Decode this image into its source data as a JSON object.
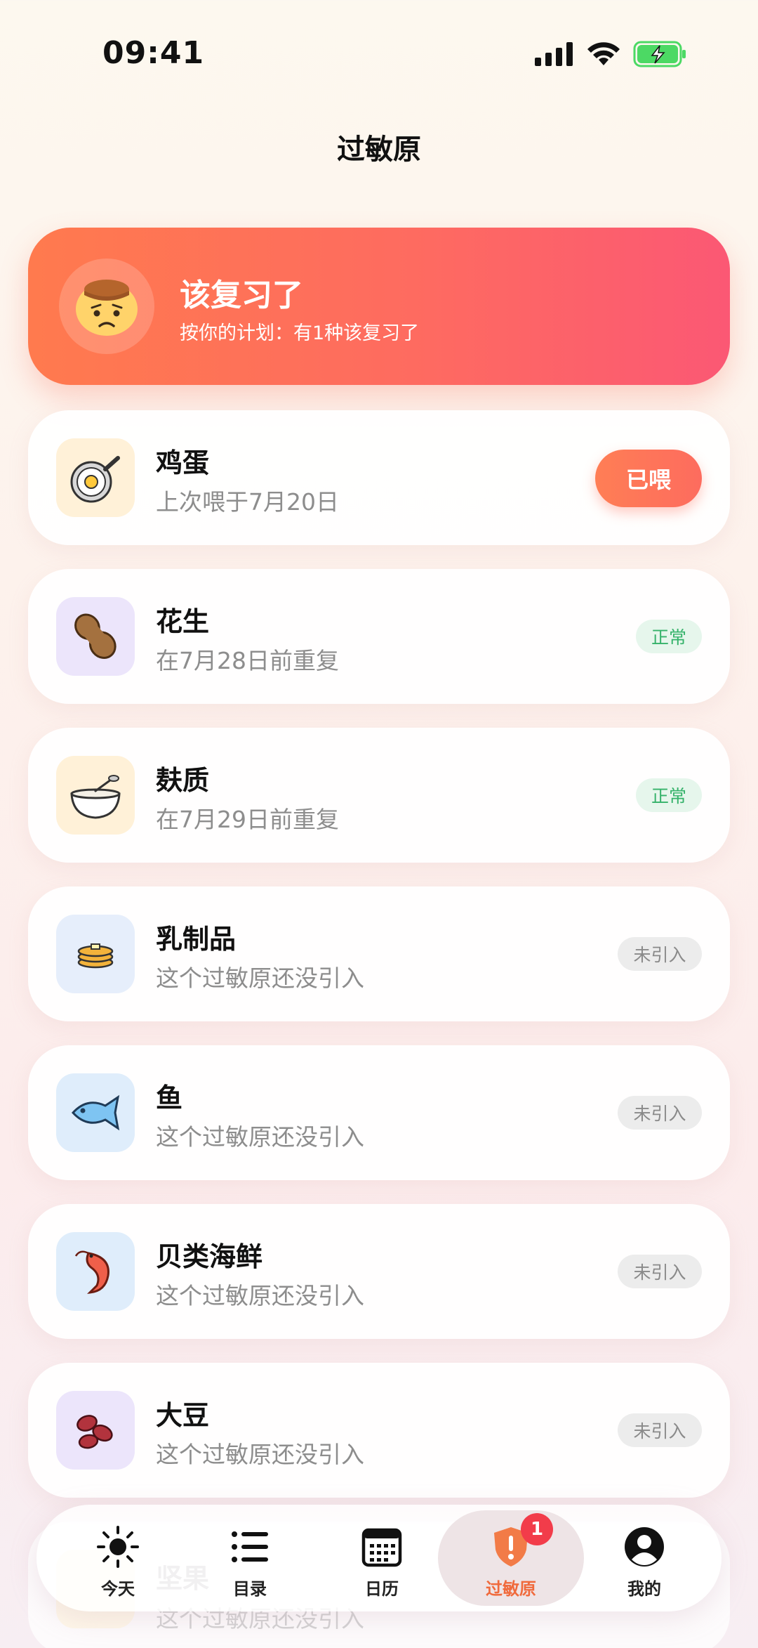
{
  "status_bar": {
    "time": "09:41"
  },
  "header": {
    "title": "过敏原"
  },
  "review_banner": {
    "title": "该复习了",
    "subtitle": "按你的计划：有1种该复习了"
  },
  "allergens": [
    {
      "name": "鸡蛋",
      "subtitle": "上次喂于7月20日",
      "action": "已喂",
      "icon": "egg-pan-icon"
    },
    {
      "name": "花生",
      "subtitle": "在7月28日前重复",
      "status": "正常",
      "icon": "peanut-icon"
    },
    {
      "name": "麸质",
      "subtitle": "在7月29日前重复",
      "status": "正常",
      "icon": "bowl-icon"
    },
    {
      "name": "乳制品",
      "subtitle": "这个过敏原还没引入",
      "status": "未引入",
      "icon": "pancake-icon"
    },
    {
      "name": "鱼",
      "subtitle": "这个过敏原还没引入",
      "status": "未引入",
      "icon": "fish-icon"
    },
    {
      "name": "贝类海鲜",
      "subtitle": "这个过敏原还没引入",
      "status": "未引入",
      "icon": "shrimp-icon"
    },
    {
      "name": "大豆",
      "subtitle": "这个过敏原还没引入",
      "status": "未引入",
      "icon": "beans-icon"
    },
    {
      "name": "坚果",
      "subtitle": "这个过敏原还没引入",
      "icon": "nut-icon"
    }
  ],
  "tab_bar": {
    "tabs": [
      {
        "label": "今天",
        "icon": "sun-icon"
      },
      {
        "label": "目录",
        "icon": "list-icon"
      },
      {
        "label": "日历",
        "icon": "calendar-icon"
      },
      {
        "label": "过敏原",
        "icon": "shield-alert-icon",
        "badge": "1",
        "active": true
      },
      {
        "label": "我的",
        "icon": "profile-icon"
      }
    ]
  },
  "colors": {
    "accent": "#fd6c5e",
    "active_tab": "#f06a3c",
    "ok_green": "#35b26a",
    "badge_red": "#f23c4a"
  }
}
